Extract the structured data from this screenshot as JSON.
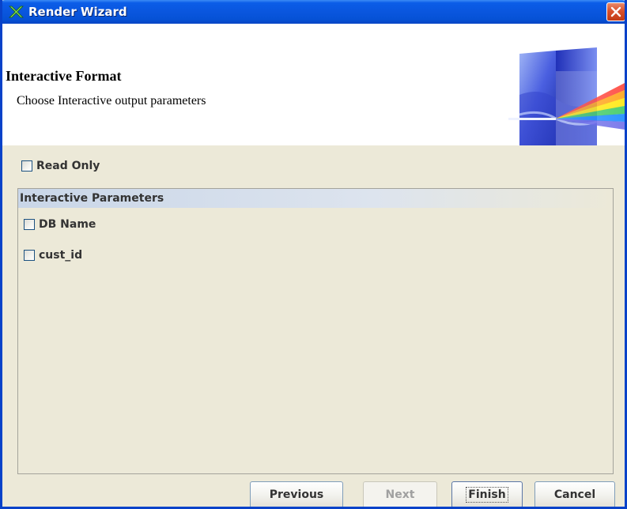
{
  "window": {
    "title": "Render Wizard",
    "icon": "render-wizard-icon",
    "close_icon": "close-icon",
    "accent_color": "#0a56de"
  },
  "header": {
    "title": "Interactive Format",
    "subtitle": "Choose Interactive output parameters",
    "graphic": "prism-icon"
  },
  "options": {
    "read_only": {
      "label": "Read Only",
      "checked": false
    }
  },
  "interactive_parameters": {
    "title": "Interactive Parameters",
    "items": [
      {
        "label": "DB Name",
        "checked": false
      },
      {
        "label": "cust_id",
        "checked": false
      }
    ]
  },
  "buttons": {
    "previous": {
      "label": "Previous",
      "enabled": true
    },
    "next": {
      "label": "Next",
      "enabled": false
    },
    "finish": {
      "label": "Finish",
      "enabled": true,
      "focused": true
    },
    "cancel": {
      "label": "Cancel",
      "enabled": true
    }
  }
}
